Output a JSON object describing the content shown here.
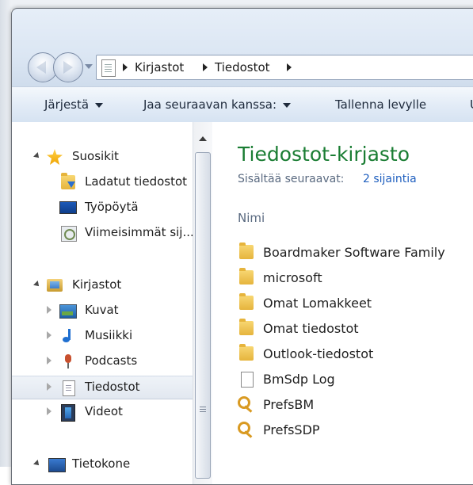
{
  "address_bar": {
    "breadcrumbs": [
      "Kirjastot",
      "Tiedostot"
    ]
  },
  "toolbar": {
    "organize_label": "Järjestä",
    "share_label": "Jaa seuraavan kanssa:",
    "burn_label": "Tallenna levylle",
    "overflow_label": "U"
  },
  "nav_pane": {
    "favorites_label": "Suosikit",
    "favorites_items": [
      "Ladatut tiedostot",
      "Työpöytä",
      "Viimeisimmät sij..."
    ],
    "libraries_label": "Kirjastot",
    "libraries_items": [
      "Kuvat",
      "Musiikki",
      "Podcasts",
      "Tiedostot",
      "Videot"
    ],
    "computer_label": "Tietokone"
  },
  "main": {
    "title": "Tiedostot-kirjasto",
    "includes_label": "Sisältää seuraavat:",
    "includes_link": "2 sijaintia",
    "column_name": "Nimi",
    "files": [
      {
        "name": "Boardmaker Software Family",
        "icon": "folder-icon"
      },
      {
        "name": "microsoft",
        "icon": "folder-icon"
      },
      {
        "name": "Omat Lomakkeet",
        "icon": "folder-icon"
      },
      {
        "name": "Omat tiedostot",
        "icon": "folder-icon"
      },
      {
        "name": "Outlook-tiedostot",
        "icon": "folder-icon"
      },
      {
        "name": "BmSdp Log",
        "icon": "text-file-icon"
      },
      {
        "name": "PrefsBM",
        "icon": "key-file-icon"
      },
      {
        "name": "PrefsSDP",
        "icon": "key-file-icon"
      }
    ]
  },
  "colors": {
    "title_green": "#1a7d33",
    "link_blue": "#1f5fbf",
    "folder_yellow": "#e6b43c"
  }
}
